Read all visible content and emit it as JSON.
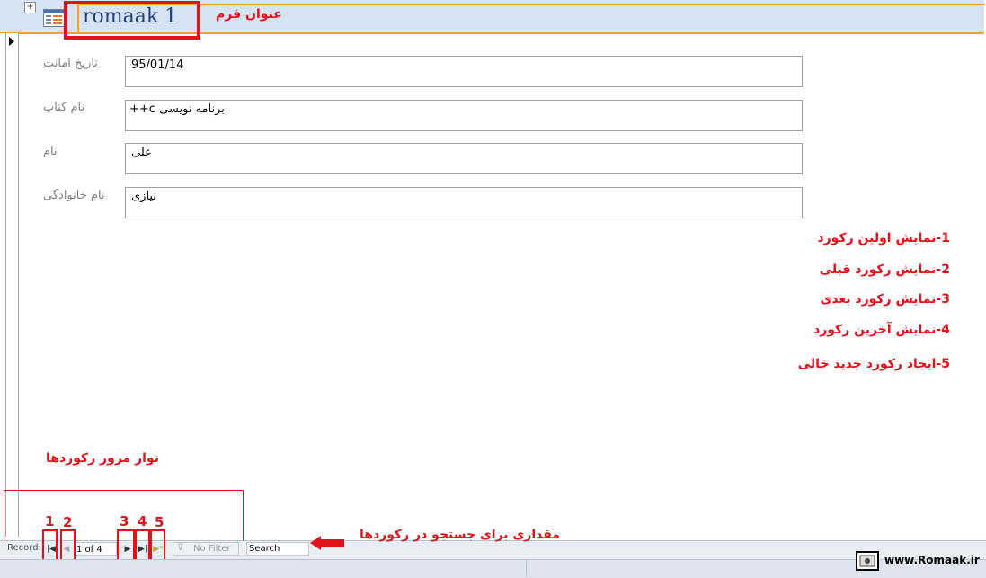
{
  "header": {
    "title": "romaak 1",
    "annotation": "عنوان فرم"
  },
  "fields": [
    {
      "label": "تاریخ امانت",
      "value": "95/01/14"
    },
    {
      "label": "نام کتاب",
      "value": "برنامه نویسی c++"
    },
    {
      "label": "نام",
      "value": "علی"
    },
    {
      "label": "نام خانوادگی",
      "value": "نیازی"
    }
  ],
  "notes": [
    "1-نمایش اولین  رکورد",
    "2-نمایش رکورد قبلی",
    "3-نمایش رکورد بعدی",
    "4-نمایش آخرین رکورد",
    "5-ایجاد رکورد جدید خالی"
  ],
  "nav_annotation": "نوار مرور رکوردها",
  "search_annotation": "مقداری برای جستجو در رکوردها",
  "nav_numbers": [
    "1",
    "2",
    "3",
    "4",
    "5"
  ],
  "nav": {
    "record_label": "Record:",
    "position": "1 of 4",
    "filter_label": "No Filter",
    "search_label": "Search"
  },
  "status": {
    "site": "www.Romaak.ir"
  },
  "colors": {
    "annotation_red": "#e2121a",
    "header_bg": "#d6e3f3",
    "header_accent": "#f4a132"
  }
}
